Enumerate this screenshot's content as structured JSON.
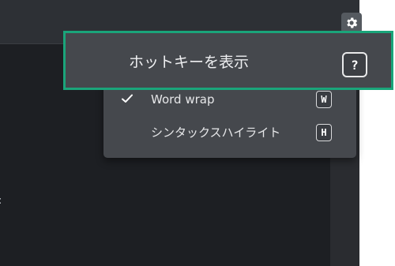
{
  "settings": {
    "icon": "gear-icon"
  },
  "editor": {
    "edge_glyph": ":"
  },
  "highlight": {
    "label": "ホットキーを表示",
    "key": "?"
  },
  "menu": {
    "items": [
      {
        "label": "Word wrap",
        "key": "W",
        "checked": true
      },
      {
        "label": "シンタックスハイライト",
        "key": "H",
        "checked": false
      }
    ]
  },
  "colors": {
    "accent_outline": "#1aa57a",
    "menu_bg": "#45484d",
    "editor_bg": "#1d1f23"
  }
}
